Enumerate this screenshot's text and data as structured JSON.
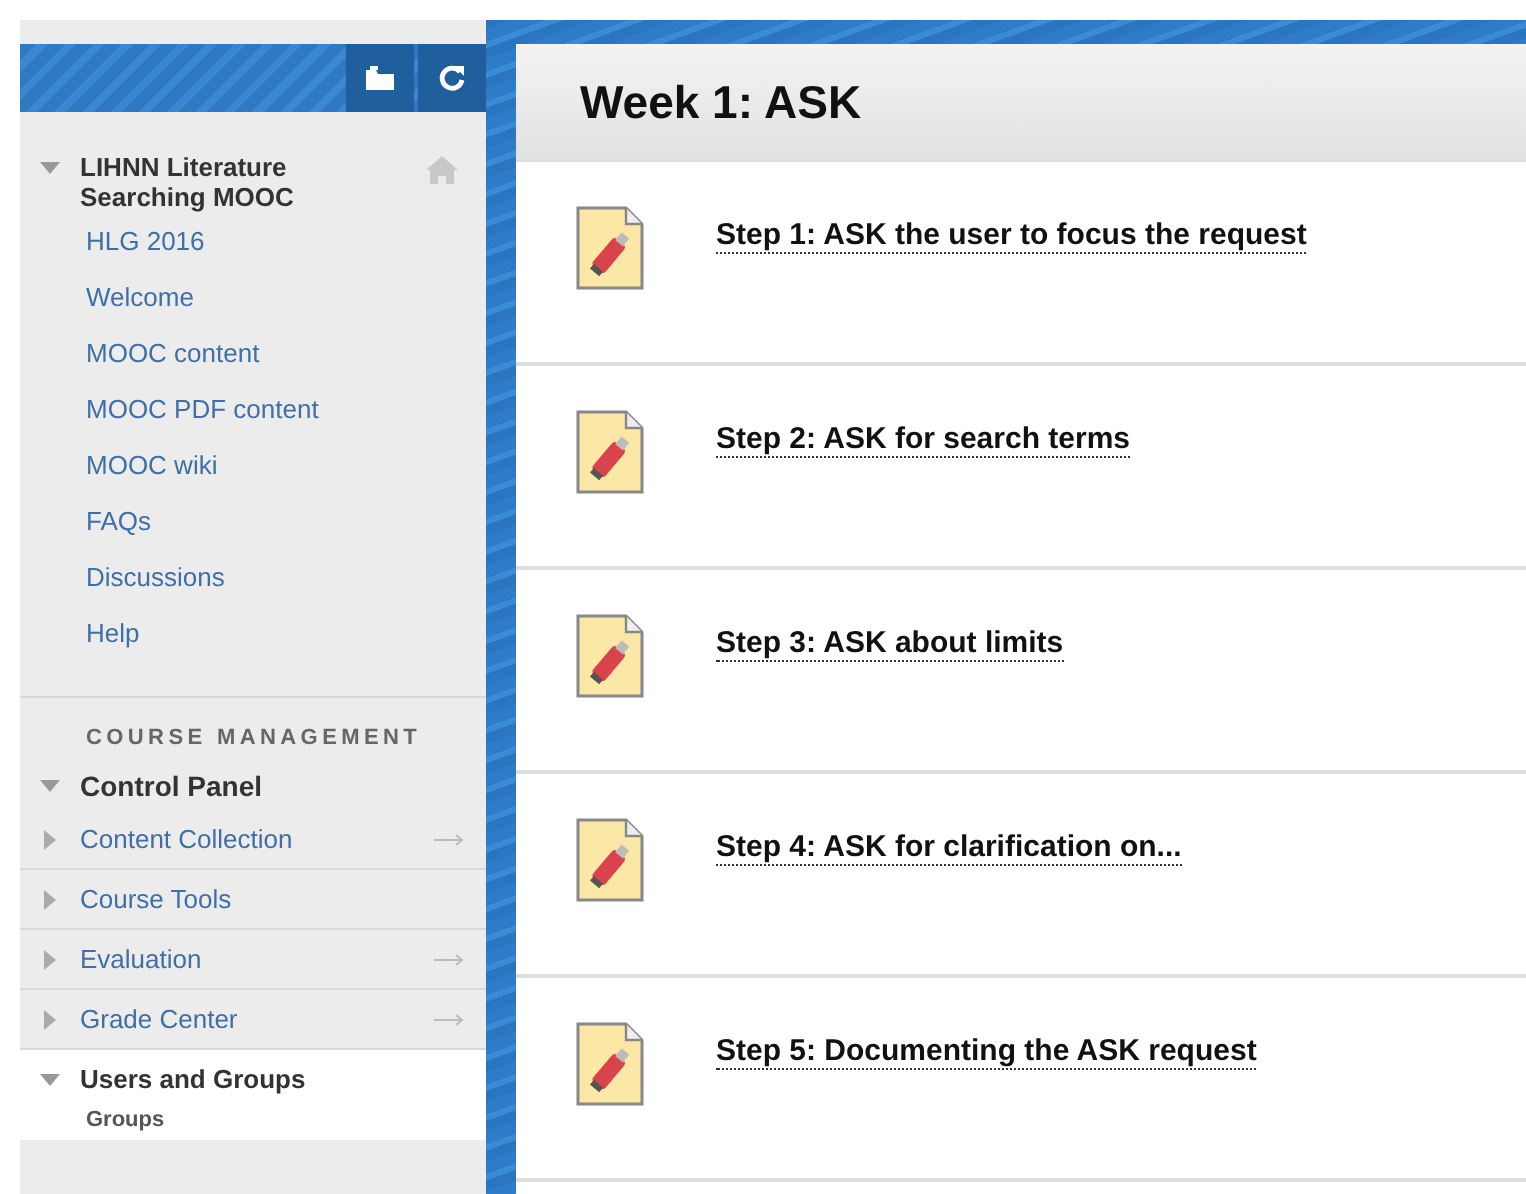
{
  "course_menu": {
    "title": "LIHNN Literature Searching MOOC",
    "expanded": true,
    "items": [
      "HLG 2016",
      "Welcome",
      "MOOC content",
      "MOOC PDF content",
      "MOOC wiki",
      "FAQs",
      "Discussions",
      "Help"
    ]
  },
  "course_management": {
    "heading": "COURSE MANAGEMENT",
    "control_panel": {
      "label": "Control Panel",
      "expanded": true
    },
    "sections": [
      {
        "label": "Content Collection",
        "expanded": false,
        "has_arrow": true
      },
      {
        "label": "Course Tools",
        "expanded": false,
        "has_arrow": false
      },
      {
        "label": "Evaluation",
        "expanded": false,
        "has_arrow": true
      },
      {
        "label": "Grade Center",
        "expanded": false,
        "has_arrow": true
      },
      {
        "label": "Users and Groups",
        "expanded": true,
        "has_arrow": false,
        "children": [
          "Groups"
        ]
      }
    ]
  },
  "page": {
    "title": "Week 1: ASK",
    "items": [
      "Step 1: ASK the user to focus the request",
      "Step 2: ASK for search terms",
      "Step 3: ASK about limits",
      "Step 4: ASK for clarification on...",
      "Step 5: Documenting the ASK request"
    ]
  }
}
